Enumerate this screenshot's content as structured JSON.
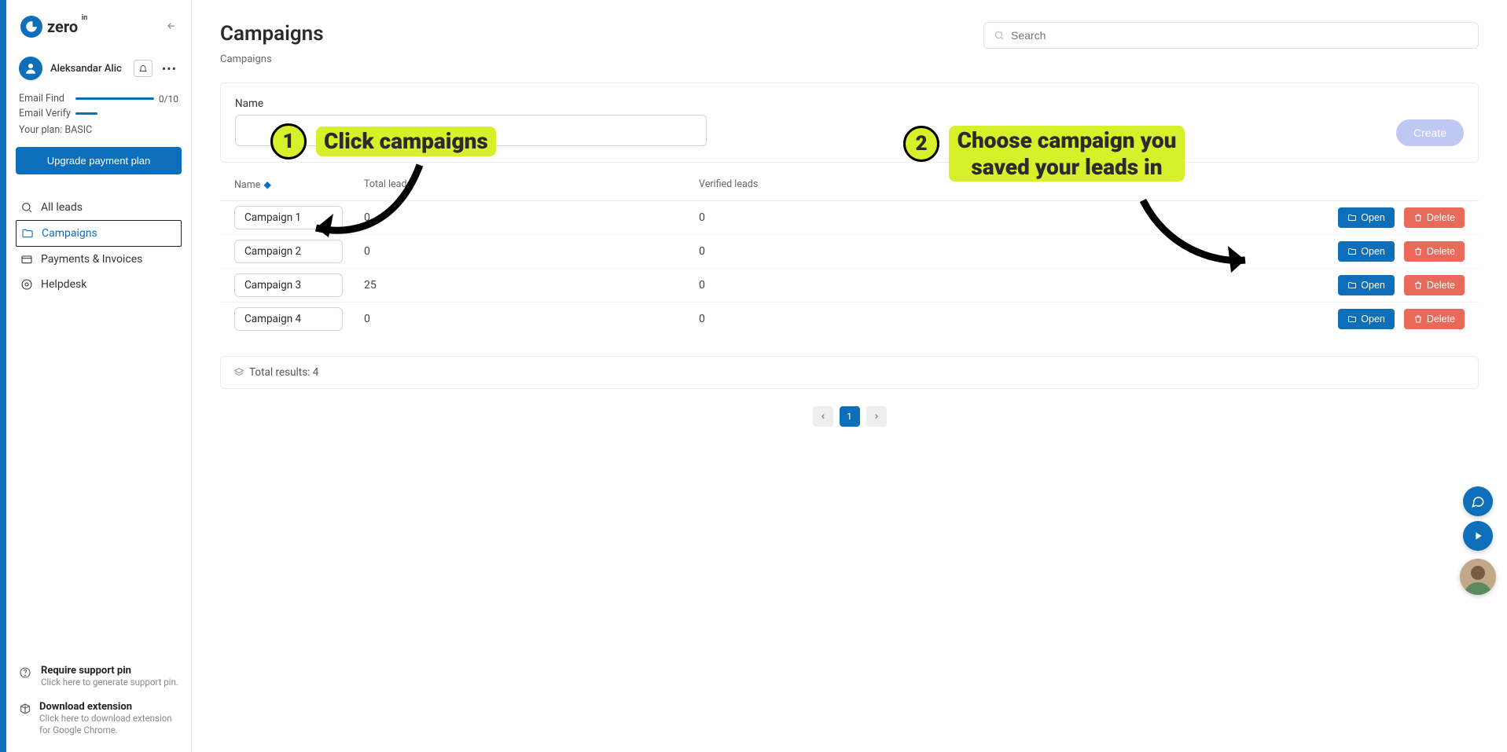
{
  "logo": {
    "text": "zero",
    "sup": "in"
  },
  "user": {
    "name": "Aleksandar Alic"
  },
  "stats": {
    "find_label": "Email Find",
    "find_val": "0/10",
    "verify_label": "Email Verify",
    "plan_label": "Your plan: BASIC",
    "upgrade_btn": "Upgrade payment plan"
  },
  "sidebar": {
    "items": [
      {
        "label": "All leads"
      },
      {
        "label": "Campaigns"
      },
      {
        "label": "Payments & Invoices"
      },
      {
        "label": "Helpdesk"
      }
    ],
    "support": {
      "title": "Require support pin",
      "sub": "Click here to generate support pin."
    },
    "download": {
      "title": "Download extension",
      "sub": "Click here to download extension for Google Chrome."
    }
  },
  "page": {
    "title": "Campaigns",
    "breadcrumb": "Campaigns",
    "search_placeholder": "Search"
  },
  "create": {
    "label": "Name",
    "btn": "Create"
  },
  "table": {
    "head": {
      "name": "Name",
      "total": "Total leads",
      "ver": "Verified leads"
    },
    "rows": [
      {
        "name": "Campaign 1",
        "total": "0",
        "ver": "0"
      },
      {
        "name": "Campaign 2",
        "total": "0",
        "ver": "0"
      },
      {
        "name": "Campaign 3",
        "total": "25",
        "ver": "0"
      },
      {
        "name": "Campaign 4",
        "total": "0",
        "ver": "0"
      }
    ],
    "open_btn": "Open",
    "del_btn": "Delete"
  },
  "footer": {
    "text": "Total results: 4"
  },
  "pager": {
    "current": "1"
  },
  "annot": {
    "a1": "Click campaigns",
    "a2": "Choose campaign you saved your leads in"
  }
}
